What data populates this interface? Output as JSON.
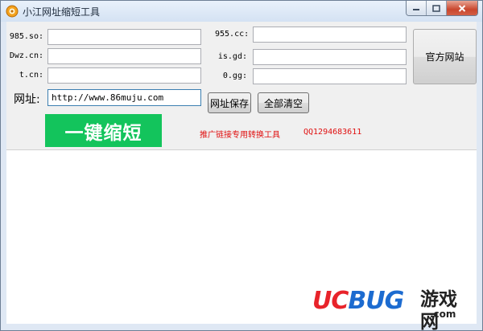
{
  "window": {
    "title": "小江网址缩短工具"
  },
  "titlebar": {
    "icon": "app-logo-icon",
    "controls": [
      "minimize-icon",
      "maximize-icon",
      "close-icon"
    ]
  },
  "fields": [
    {
      "label": "985.so:",
      "value": ""
    },
    {
      "label": "Dwz.cn:",
      "value": ""
    },
    {
      "label": "t.cn:",
      "value": ""
    },
    {
      "label": "955.cc:",
      "value": ""
    },
    {
      "label": "is.gd:",
      "value": ""
    },
    {
      "label": "0.gg:",
      "value": ""
    }
  ],
  "url": {
    "label": "网址:",
    "value": "http://www.86muju.com"
  },
  "buttons": {
    "save": "网址保存",
    "clear": "全部清空",
    "official_site": "官方网站",
    "shorten": "一键缩短"
  },
  "promo": {
    "text": "推广链接专用转换工具",
    "qq": "QQ1294683611"
  },
  "watermark": {
    "logo_uc": "UC",
    "logo_bug": "BUG",
    "cn": "游戏网",
    "domain": ".com"
  },
  "colors": {
    "shorten_bg": "#13c45c",
    "promo_red": "#e01010",
    "logo_red": "#e8232a",
    "logo_blue": "#1c6bd0"
  }
}
